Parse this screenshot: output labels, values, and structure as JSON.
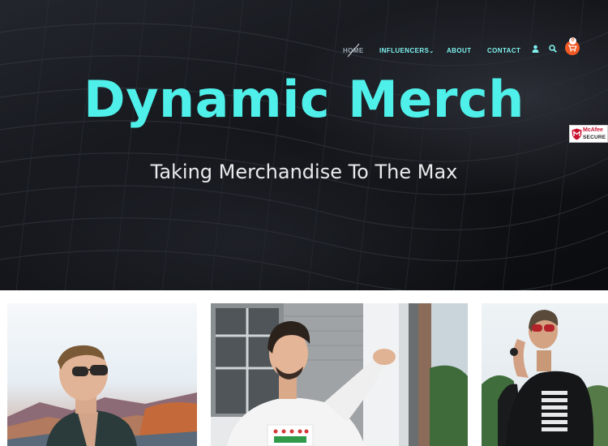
{
  "nav": {
    "items": [
      {
        "label": "HOME",
        "active": true
      },
      {
        "label": "INFLUENCERS",
        "has_dropdown": true
      },
      {
        "label": "ABOUT"
      },
      {
        "label": "CONTACT"
      }
    ],
    "icons": [
      "user-icon",
      "search-icon",
      "cart-icon"
    ],
    "cart_count": "0"
  },
  "hero": {
    "title": "Dynamic Merch",
    "subtitle": "Taking Merchandise To The Max"
  },
  "badge": {
    "brand": "McAfee",
    "secure": "SECURE"
  },
  "colors": {
    "accent": "#4ff0ea",
    "nav_text": "#7ff2ee",
    "cart": "#f15a24",
    "hero_bg": "#111318"
  },
  "cards": [
    {
      "name": "influencer-card-1"
    },
    {
      "name": "influencer-card-2"
    },
    {
      "name": "influencer-card-3"
    }
  ]
}
